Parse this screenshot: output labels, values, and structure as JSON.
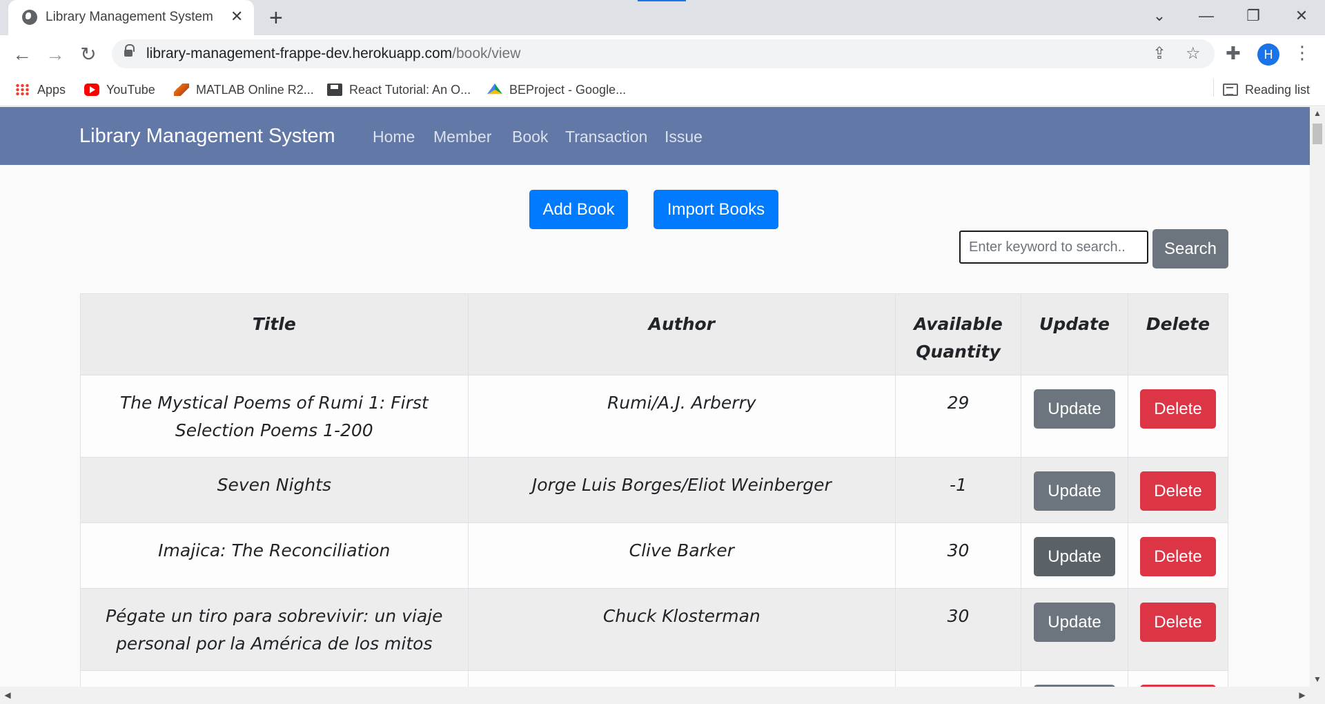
{
  "browser": {
    "tab_title": "Library Management System",
    "tab_close": "✕",
    "new_tab": "+",
    "url_host": "library-management-frappe-dev.herokuapp.com",
    "url_path": "/book/view",
    "profile_initial": "H",
    "bookmarks": [
      {
        "label": "Apps",
        "icon": "apps-icon"
      },
      {
        "label": "YouTube",
        "icon": "youtube-icon"
      },
      {
        "label": "MATLAB Online R2...",
        "icon": "matlab-icon"
      },
      {
        "label": "React Tutorial: An O...",
        "icon": "floppy-icon"
      },
      {
        "label": "BEProject - Google...",
        "icon": "google-drive-icon"
      }
    ],
    "reading_list": "Reading list"
  },
  "navbar": {
    "brand": "Library Management System",
    "links": [
      "Home",
      "Member",
      "Book",
      "Transaction",
      "Issue"
    ]
  },
  "actions": {
    "add_book": "Add Book",
    "import_books": "Import Books"
  },
  "search": {
    "placeholder": "Enter keyword to search..",
    "button": "Search"
  },
  "table": {
    "headers": [
      "Title",
      "Author",
      "Available Quantity",
      "Update",
      "Delete"
    ],
    "update_label": "Update",
    "delete_label": "Delete",
    "rows": [
      {
        "title": "The Mystical Poems of Rumi 1: First Selection Poems 1-200",
        "author": "Rumi/A.J. Arberry",
        "quantity": "29"
      },
      {
        "title": "Seven Nights",
        "author": "Jorge Luis Borges/Eliot Weinberger",
        "quantity": "-1"
      },
      {
        "title": "Imajica: The Reconciliation",
        "author": "Clive Barker",
        "quantity": "30"
      },
      {
        "title": "Pégate un tiro para sobrevivir: un viaje personal por la América de los mitos",
        "author": "Chuck Klosterman",
        "quantity": "30"
      }
    ]
  }
}
